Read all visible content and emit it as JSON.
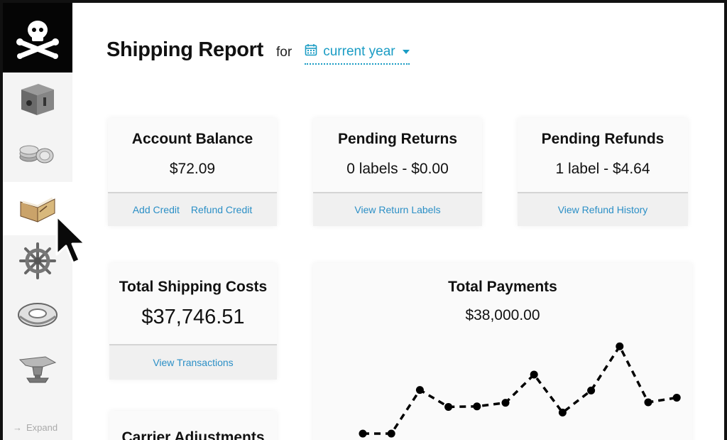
{
  "sidebar": {
    "items": [
      {
        "icon": "shipping-box-icon"
      },
      {
        "icon": "coins-icon"
      },
      {
        "icon": "open-book-icon",
        "active": true
      },
      {
        "icon": "ship-wheel-icon"
      },
      {
        "icon": "life-ring-icon"
      },
      {
        "icon": "anvil-icon"
      }
    ],
    "expand_label": "Expand"
  },
  "header": {
    "title": "Shipping Report",
    "for_label": "for",
    "period": "current year"
  },
  "cards": {
    "account_balance": {
      "title": "Account Balance",
      "value": "$72.09",
      "links": [
        "Add Credit",
        "Refund Credit"
      ]
    },
    "pending_returns": {
      "title": "Pending Returns",
      "value": "0 labels - $0.00",
      "link": "View Return Labels"
    },
    "pending_refunds": {
      "title": "Pending Refunds",
      "value": "1 label - $4.64",
      "link": "View Refund History"
    },
    "total_shipping_costs": {
      "title": "Total Shipping Costs",
      "value": "$37,746.51",
      "link": "View Transactions"
    },
    "carrier_adjustments": {
      "title": "Carrier Adjustments"
    },
    "total_payments": {
      "title": "Total Payments",
      "value": "$38,000.00"
    }
  },
  "colors": {
    "accent": "#1a9cc4",
    "link": "#2b8fc6",
    "sidebar_bg": "#f4f4f4",
    "logo_bg": "#050505"
  },
  "chart_data": {
    "type": "line",
    "series": [
      {
        "values": [
          0,
          0,
          8.5,
          5.2,
          5.3,
          6.0,
          11.5,
          4.1,
          8.4,
          17.0,
          6.1,
          7.0
        ]
      }
    ],
    "ylim": [
      0,
      18
    ]
  }
}
